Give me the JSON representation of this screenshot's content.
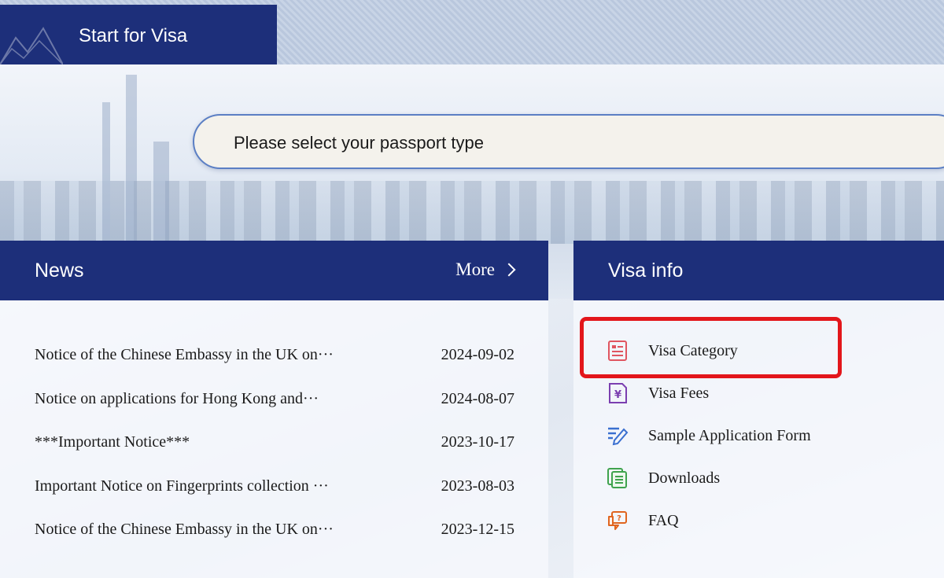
{
  "top_tab": {
    "title": "Start for Visa"
  },
  "passport_select": {
    "placeholder": "Please select your passport type"
  },
  "news": {
    "title": "News",
    "more_label": "More",
    "items": [
      {
        "title": "Notice of the Chinese Embassy in the UK on···",
        "date": "2024-09-02"
      },
      {
        "title": "Notice on applications for Hong Kong and···",
        "date": "2024-08-07"
      },
      {
        "title": "***Important Notice***",
        "date": "2023-10-17"
      },
      {
        "title": "Important Notice on Fingerprints collection ···",
        "date": "2023-08-03"
      },
      {
        "title": "Notice of the Chinese Embassy in the UK on···",
        "date": "2023-12-15"
      }
    ]
  },
  "visa_info": {
    "title": "Visa info",
    "items": [
      {
        "label": "Visa Category",
        "icon": "list-document-icon",
        "color": "#e05560"
      },
      {
        "label": "Visa Fees",
        "icon": "yen-document-icon",
        "color": "#7b3fb0"
      },
      {
        "label": "Sample Application Form",
        "icon": "pen-lines-icon",
        "color": "#3a6fd0"
      },
      {
        "label": "Downloads",
        "icon": "stacked-documents-icon",
        "color": "#3fa34d"
      },
      {
        "label": "FAQ",
        "icon": "question-chat-icon",
        "color": "#e0651f"
      }
    ]
  },
  "colors": {
    "header_navy": "#1d2f7a",
    "highlight_red": "#e3161b",
    "select_border": "#5b7fc4"
  }
}
